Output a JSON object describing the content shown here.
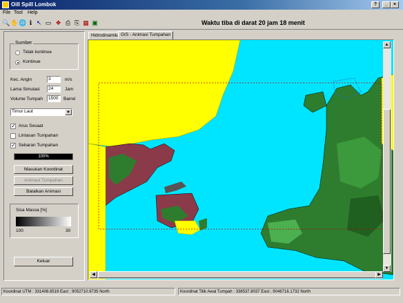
{
  "window": {
    "title": "Oill Spill Lombok",
    "btn_help": "?",
    "btn_min": "_",
    "btn_max": "□",
    "btn_close": "×"
  },
  "menu": [
    "File",
    "Tool",
    "Help"
  ],
  "toolbar": {
    "tools": [
      {
        "icon": "magnifier-icon",
        "glyph": "🔍"
      },
      {
        "icon": "hand-icon",
        "glyph": "✋"
      },
      {
        "icon": "globe-icon",
        "glyph": "🌐"
      },
      {
        "icon": "info-icon",
        "glyph": "ℹ"
      },
      {
        "icon": "pointer-icon",
        "glyph": "↖"
      },
      {
        "icon": "ruler-icon",
        "glyph": "▭"
      },
      {
        "icon": "spill-icon",
        "glyph": "❖"
      },
      {
        "icon": "print-icon",
        "glyph": "⎙"
      },
      {
        "icon": "copy-icon",
        "glyph": "⎘"
      },
      {
        "icon": "chart-icon",
        "glyph": "▦"
      },
      {
        "icon": "layer-icon",
        "glyph": "▣"
      }
    ],
    "waktu": "Waktu tiba di darat 20 jam 18 menit"
  },
  "panel": {
    "sumber": {
      "title": "Sumber",
      "opt1": "Tidak kontinue",
      "opt2": "Kontinue"
    },
    "kec_angin": {
      "label": "Kec. Angin",
      "value": "3",
      "unit": "m/s"
    },
    "lama_simulasi": {
      "label": "Lama Simulasi",
      "value": "24",
      "unit": "Jam"
    },
    "volume_tumpah": {
      "label": "Volume Tumpah",
      "value": "1500",
      "unit": "Barrel"
    },
    "arah": {
      "value": "Timur Laut"
    },
    "arus_sesaat": {
      "label": "Arus Sesaat",
      "checked": "✓"
    },
    "lintasan": {
      "label": "Lintasan Tumpahan"
    },
    "sebaran": {
      "label": "Sebaran Tumpahan",
      "checked": "✓"
    },
    "progress": {
      "text": "100%",
      "value": 1.0
    },
    "btn_masukan": "Masukan Koordinat",
    "btn_animasi": "Animasi Tumpahan",
    "btn_batalkan": "Batalkan Animasi",
    "sisa_massa": {
      "title": "Sisa Massa [%]",
      "left": "100",
      "right": "30"
    },
    "btn_keluar": "Keluar"
  },
  "tabs": [
    "Hidrodinamika",
    "GIS - Animasi Tumpahan"
  ],
  "status": {
    "utm": "Koordinat UTM : 331408.8519 East ; 9052710.9735 North",
    "awal": "Koordinat Titik Awal Tumpah : 338537.8037 East ; 9046716.1732 North"
  },
  "colors": {
    "sea": "#00e5ff",
    "land_yellow": "#ffff00",
    "forest": "#2e7d2e",
    "spill": "#8b3a4a"
  }
}
